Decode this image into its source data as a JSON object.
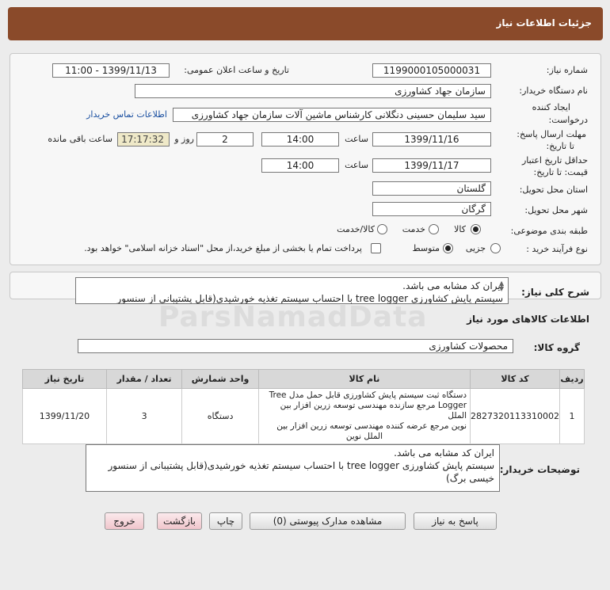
{
  "header": {
    "title": "جزئیات اطلاعات نیاز"
  },
  "form": {
    "need_number_label": "شماره نیاز:",
    "need_number": "1199000105000031",
    "announce_label": "تاریخ و ساعت اعلان عمومی:",
    "announce_value": "1399/11/13 - 11:00",
    "buyer_org_label": "نام دستگاه خریدار:",
    "buyer_org": "سازمان جهاد کشاورزی",
    "creator_label_1": "ایجاد کننده",
    "creator_label_2": "درخواست:",
    "creator": "سید سلیمان حسینی دنگلانی کارشناس ماشین آلات سازمان جهاد کشاورزی",
    "contact_link": "اطلاعات تماس خریدار",
    "deadline_label_1": "مهلت ارسال پاسخ:",
    "deadline_label_2": "تا تاریخ:",
    "deadline_date": "1399/11/16",
    "time_label": "ساعت",
    "deadline_time": "14:00",
    "days_value": "2",
    "days_label": "روز و",
    "remain_time": "17:17:32",
    "remain_label": "ساعت باقی مانده",
    "validity_label_1": "حداقل تاریخ اعتبار",
    "validity_label_2": "قیمت: تا تاریخ:",
    "validity_date": "1399/11/17",
    "validity_time": "14:00",
    "province_label": "استان محل تحویل:",
    "province": "گلستان",
    "city_label": "شهر محل تحویل:",
    "city": "گرگان",
    "category_label": "طبقه بندی موضوعی:",
    "cat_goods": "کالا",
    "cat_service": "خدمت",
    "cat_both": "کالا/خدمت",
    "process_label": "نوع فرآیند خرید :",
    "proc_partial": "جزیی",
    "proc_medium": "متوسط",
    "payment_text": "پرداخت تمام یا بخشی از مبلغ خرید،از محل \"اسناد خزانه اسلامی\" خواهد بود."
  },
  "summary": {
    "label": "شرح کلی نیاز:",
    "line1": "ایران کد مشابه می باشد.",
    "line2": "سیستم پایش کشاورزی tree logger  با احتساب سیستم تغذیه خورشیدی(قابل پشتیبانی از سنسور"
  },
  "goods_section_title": "اطلاعات کالاهای مورد نیاز",
  "group": {
    "label": "گروه کالا:",
    "value": "محصولات کشاورزی"
  },
  "table": {
    "headers": [
      "ردیف",
      "کد کالا",
      "نام کالا",
      "واحد شمارش",
      "تعداد / مقدار",
      "تاریخ نیاز"
    ],
    "row": {
      "index": "1",
      "code": "2827320113310002",
      "name_l1": "دستگاه ثبت سیستم پایش کشاورزی قابل حمل مدل Tree",
      "name_l2": "Logger مرجع سازنده مهندسی توسعه زرین افزار بین الملل",
      "name_l3": "نوین مرجع عرضه کننده مهندسی توسعه زرین افزار بین",
      "name_l4": "الملل نوین",
      "unit": "دستگاه",
      "qty": "3",
      "date": "1399/11/20"
    }
  },
  "buyer_notes": {
    "label": "توضیحات خریدار:",
    "line1": "ایران کد مشابه می باشد.",
    "line2": "سیستم پایش کشاورزی tree logger  با احتساب سیستم تغذیه خورشیدی(قابل پشتیبانی از سنسور",
    "line3": "خیسی برگ)"
  },
  "buttons": {
    "reply": "پاسخ به نیاز",
    "view_docs": "مشاهده مدارک پیوستی (0)",
    "print": "چاپ",
    "back": "بازگشت",
    "exit": "خروج"
  },
  "watermark": "ParsNamadData"
}
